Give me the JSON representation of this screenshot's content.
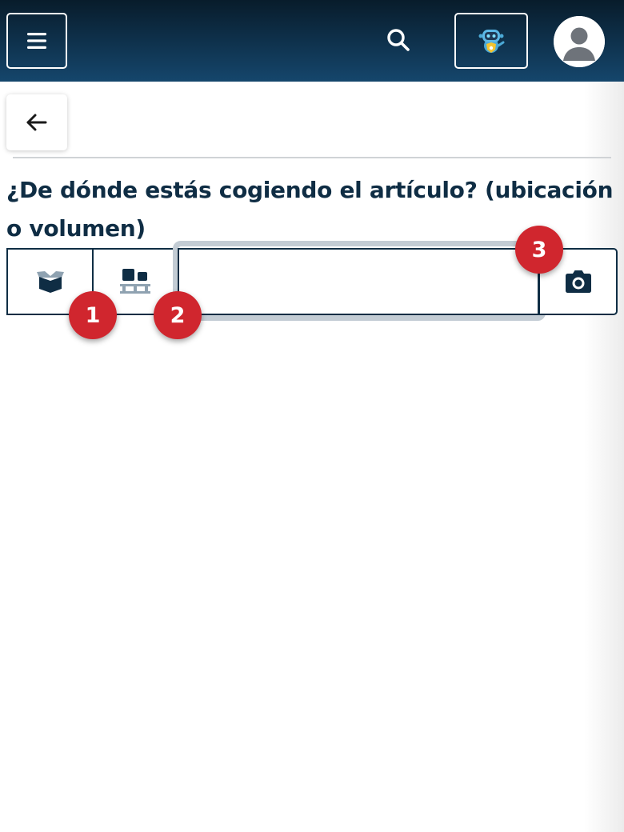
{
  "header": {
    "menu_icon": "hamburger-menu-icon",
    "search_icon": "search-icon",
    "assistant_icon": "robot-assistant-icon",
    "avatar_icon": "user-avatar-icon"
  },
  "navigation": {
    "back_icon": "arrow-left-icon"
  },
  "question": {
    "text": "¿De dónde estás cogiendo el artículo? (ubicación o volumen)"
  },
  "location_input": {
    "value": "",
    "placeholder": "",
    "box_icon": "open-box-icon",
    "pallet_icon": "pallet-icon",
    "camera_icon": "camera-icon"
  },
  "badges": {
    "one": "1",
    "two": "2",
    "three": "3"
  },
  "colors": {
    "header_dark": "#081c2b",
    "header_light": "#15466c",
    "primary_text": "#0f2d44",
    "badge_red": "#d0262e",
    "focus_ring": "#c3ccd4"
  }
}
